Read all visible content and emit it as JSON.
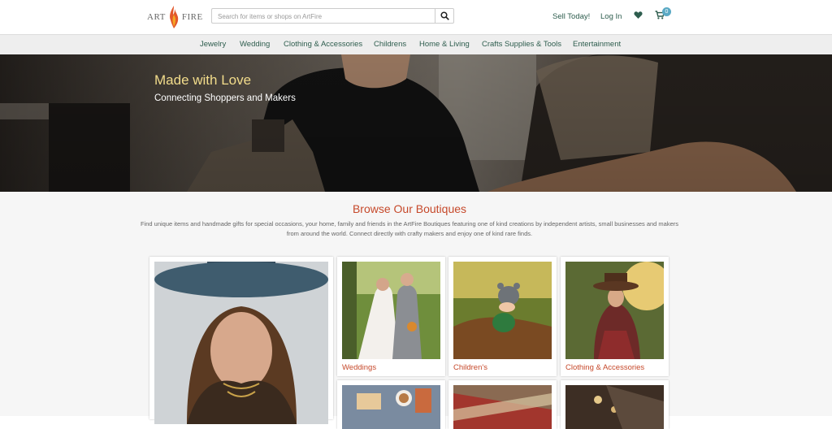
{
  "header": {
    "logo_left": "ART",
    "logo_right": "FIRE",
    "search_placeholder": "Search for items or shops on ArtFire",
    "sell_today": "Sell Today!",
    "log_in": "Log In",
    "cart_count": "0",
    "icons": [
      "search-icon",
      "heart-icon",
      "cart-icon"
    ]
  },
  "nav": {
    "items": [
      "Jewelry",
      "Wedding",
      "Clothing & Accessories",
      "Childrens",
      "Home & Living",
      "Crafts Supplies & Tools",
      "Entertainment"
    ]
  },
  "hero": {
    "title": "Made with Love",
    "subtitle": "Connecting Shoppers and Makers"
  },
  "boutiques": {
    "title": "Browse Our Boutiques",
    "description": "Find unique items and handmade gifts for special occasions, your home, family and friends in the ArtFire Boutiques featuring one of kind creations by independent artists, small businesses and makers from around the world. Connect directly with crafty makers and enjoy one of kind rare finds.",
    "cards": [
      {
        "label": "Weddings"
      },
      {
        "label": "Children's"
      },
      {
        "label": "Clothing & Accessories"
      }
    ]
  },
  "colors": {
    "accent": "#c6492b",
    "nav_text": "#2e5d4e",
    "hero_title": "#f2dc8b",
    "badge": "#5aa9c4"
  }
}
